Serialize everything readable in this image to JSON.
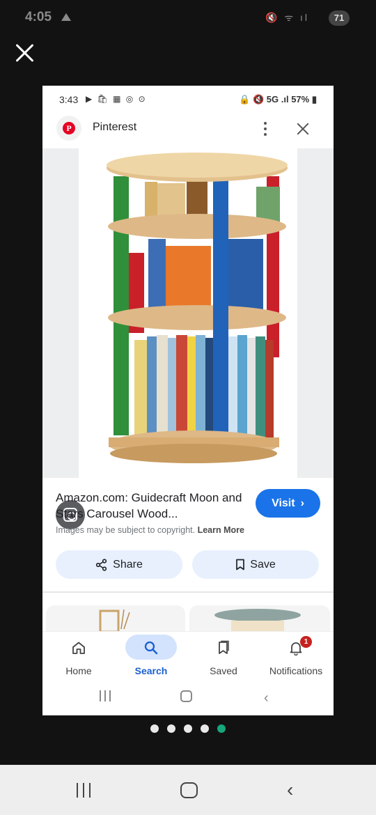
{
  "outer_status": {
    "time": "4:05",
    "icons_text": "🔇 ᯤ ıl",
    "battery": "71"
  },
  "inner_status": {
    "time": "3:43",
    "app_icons": "▶ 🛍 ▦ ◎ ⊙",
    "right": "🔒 🔇 5G .ıl 57% ▮"
  },
  "header": {
    "title": "Pinterest",
    "logo_letter": "P"
  },
  "result": {
    "title": "Amazon.com: Guidecraft Moon and Stars Carousel Wood...",
    "visit_label": "Visit",
    "visit_chevron": "›",
    "copyright": "Images may be subject to copyright.",
    "learn_more": "Learn More"
  },
  "actions": {
    "share_label": "Share",
    "save_label": "Save"
  },
  "bottom_nav": [
    {
      "label": "Home",
      "icon": "home-icon"
    },
    {
      "label": "Search",
      "icon": "search-icon",
      "active": true
    },
    {
      "label": "Saved",
      "icon": "bookmarks-icon"
    },
    {
      "label": "Notifications",
      "icon": "bell-icon",
      "badge": "1"
    }
  ],
  "pager": {
    "total": 5,
    "active_index": 4
  },
  "colors": {
    "accent_blue": "#1a73e8",
    "pill_bg": "#e8f0fe",
    "pager_active": "#18a57c",
    "pinterest_red": "#e60023"
  }
}
